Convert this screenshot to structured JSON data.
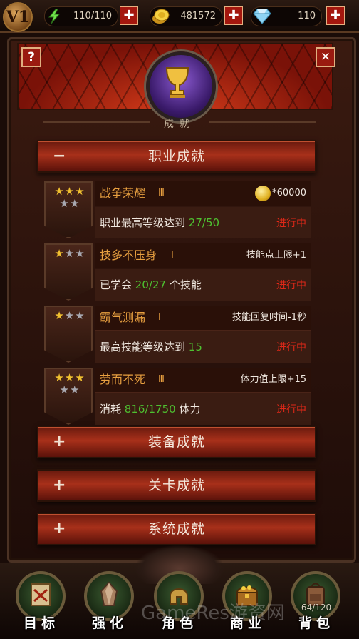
{
  "topbar": {
    "vip_label": "V1",
    "energy": "110/110",
    "gold": "481572",
    "diamonds": "110",
    "plus_symbol": "✚"
  },
  "header": {
    "help_label": "?",
    "close_label": "✕",
    "title": "成就"
  },
  "categories": [
    {
      "sign": "−",
      "label": "职业成就"
    },
    {
      "sign": "+",
      "label": "装备成就"
    },
    {
      "sign": "+",
      "label": "关卡成就"
    },
    {
      "sign": "+",
      "label": "系统成就"
    }
  ],
  "achievements": [
    {
      "name": "战争荣耀",
      "level": "Ⅲ",
      "stars_gold": "★★★",
      "stars_silver": "★★",
      "reward": "*60000",
      "reward_type": "gold-coin",
      "desc_prefix": "职业最高等级达到",
      "progress": "27/50",
      "desc_suffix": "",
      "status": "进行中"
    },
    {
      "name": "技多不压身",
      "level": "Ⅰ",
      "stars_gold": "★",
      "stars_silver": "★★",
      "reward": "技能点上限+1",
      "desc_prefix": "已学会",
      "progress": "20/27",
      "desc_suffix": "个技能",
      "status": "进行中"
    },
    {
      "name": "霸气测漏",
      "level": "Ⅰ",
      "stars_gold": "★",
      "stars_silver": "★★",
      "reward": "技能回复时间-1秒",
      "desc_prefix": "最高技能等级达到",
      "progress": "15",
      "desc_suffix": "",
      "status": "进行中"
    },
    {
      "name": "劳而不死",
      "level": "Ⅲ",
      "stars_gold": "★★★",
      "stars_silver": "★★",
      "reward": "体力值上限+15",
      "desc_prefix": "消耗",
      "progress": "816/1750",
      "desc_suffix": "体力",
      "status": "进行中"
    }
  ],
  "nav": [
    {
      "label": "目标",
      "icon": "map-scroll-icon"
    },
    {
      "label": "强化",
      "icon": "crystal-icon"
    },
    {
      "label": "角色",
      "icon": "helmet-icon"
    },
    {
      "label": "商业",
      "icon": "treasure-chest-icon"
    },
    {
      "label": "背包",
      "icon": "backpack-icon",
      "count": "64/120"
    }
  ],
  "watermark": "GameRes游资网",
  "colors": {
    "progress_green": "#4ec030",
    "status_red": "#e02818",
    "name_orange": "#e8a040",
    "button_red": "#a4170e"
  }
}
